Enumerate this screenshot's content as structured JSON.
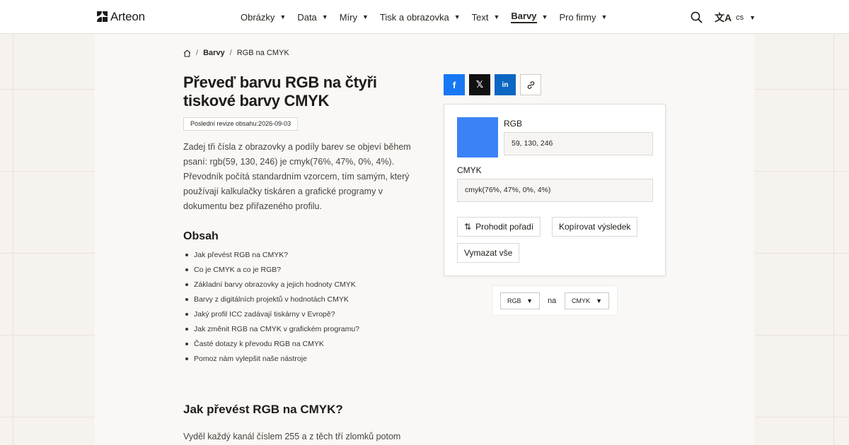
{
  "header": {
    "brand": "Arteon",
    "nav": [
      {
        "label": "Obrázky",
        "active": false
      },
      {
        "label": "Data",
        "active": false
      },
      {
        "label": "Míry",
        "active": false
      },
      {
        "label": "Tisk a obrazovka",
        "active": false
      },
      {
        "label": "Text",
        "active": false
      },
      {
        "label": "Barvy",
        "active": true
      },
      {
        "label": "Pro firmy",
        "active": false
      }
    ],
    "caret": "▼",
    "search_icon": "search-icon",
    "translate_glyph": "文A",
    "language": "cs"
  },
  "breadcrumb": {
    "home_icon": "home-icon",
    "separator": "/",
    "items": [
      "Barvy",
      "RGB na CMYK"
    ]
  },
  "article": {
    "title": "Převeď barvu RGB na čtyři tiskové barvy CMYK",
    "revision": "Poslední revize obsahu:2026-09-03",
    "intro": "Zadej tři čísla z obrazovky a podíly barev se objeví během psaní: rgb(59, 130, 246) je cmyk(76%, 47%, 0%, 4%). Převodník počítá standardním vzorcem, tím samým, který používají kalkulačky tiskáren a grafické programy v dokumentu bez přiřazeného profilu.",
    "toc_title": "Obsah",
    "toc": [
      "Jak převést RGB na CMYK?",
      "Co je CMYK a co je RGB?",
      "Základní barvy obrazovky a jejich hodnoty CMYK",
      "Barvy z digitálních projektů v hodnotách CMYK",
      "Jaký profil ICC zadávají tiskárny v Evropě?",
      "Jak změnit RGB na CMYK v grafickém programu?",
      "Časté dotazy k převodu RGB na CMYK",
      "Pomoz nám vylepšit naše nástroje"
    ],
    "section_title": "Jak převést RGB na CMYK?",
    "section_text": "Vyděl každý kanál číslem 255 a z těch tří zlomků potom"
  },
  "share": {
    "facebook": "f",
    "x": "𝕏",
    "linkedin": "in",
    "link_glyph": "🔗"
  },
  "converter": {
    "swatch_color": "#3b82f6",
    "rgb_label": "RGB",
    "rgb_value": "59, 130, 246",
    "cmyk_label": "CMYK",
    "cmyk_value": "cmyk(76%, 47%, 0%, 4%)",
    "swap_glyph": "⇅",
    "swap_label": "Prohodit pořadí",
    "copy_label": "Kopírovat výsledek",
    "clear_label": "Vymazat vše"
  },
  "selector": {
    "from": "RGB",
    "joiner": "na",
    "to": "CMYK",
    "caret": "▼"
  }
}
